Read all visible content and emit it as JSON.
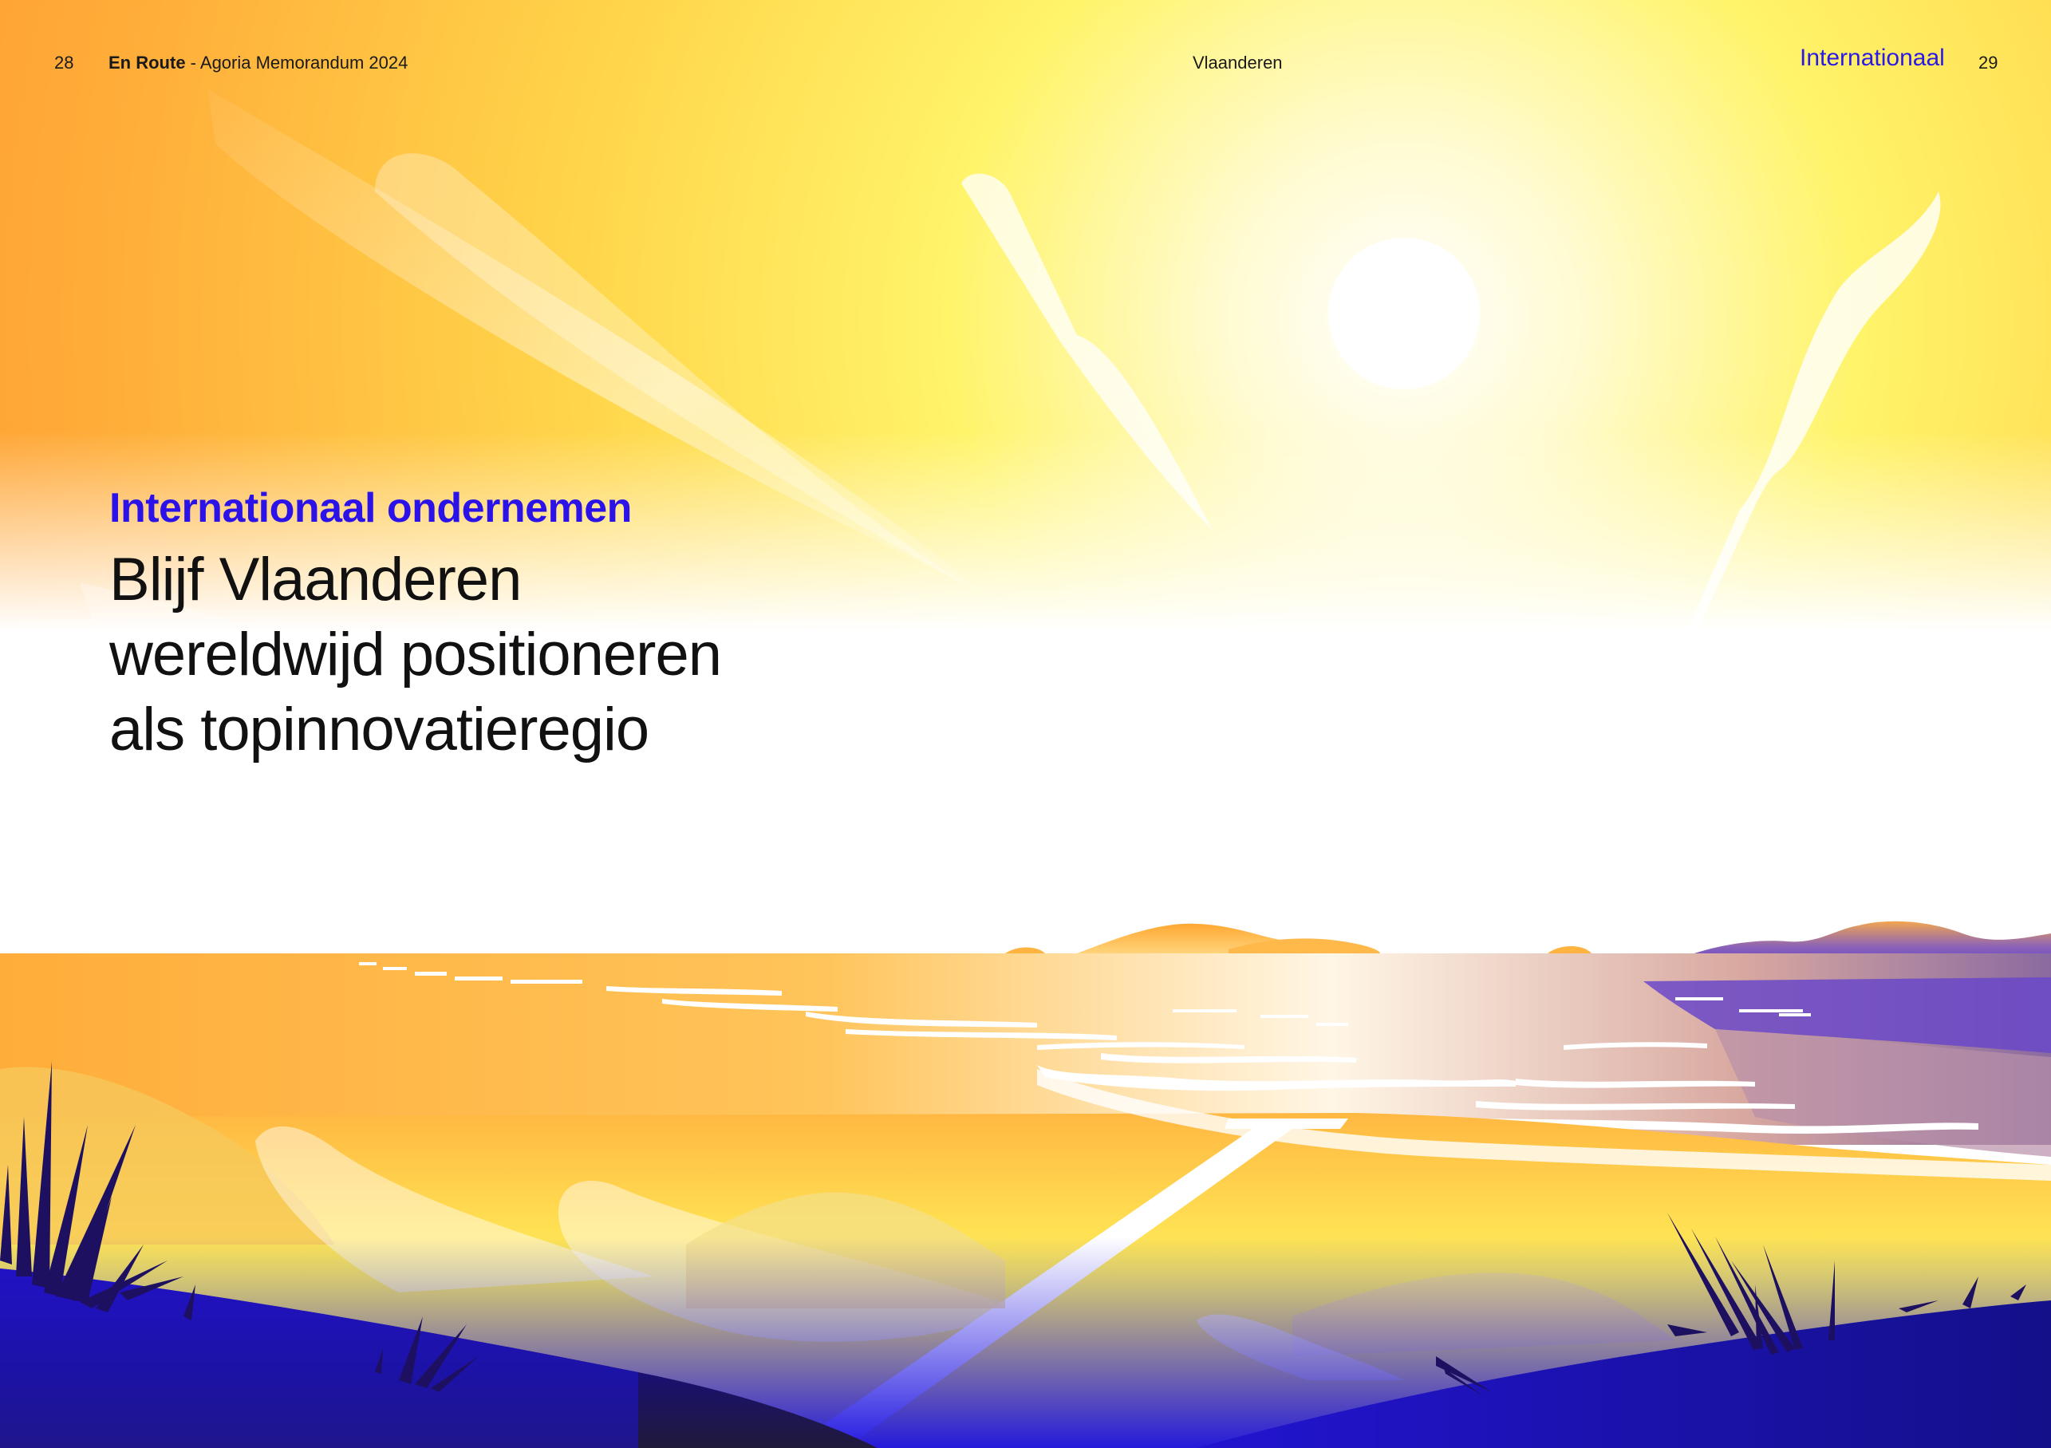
{
  "header": {
    "page_left": "28",
    "publication_bold": "En Route",
    "publication_rest": " - Agoria Memorandum 2024",
    "center_label": "Vlaanderen",
    "section": "Internationaal",
    "page_right": "29"
  },
  "content": {
    "kicker": "Internationaal ondernemen",
    "headline_lines": [
      "Blijf Vlaanderen",
      "wereldwijd positioneren",
      "als topinnovatieregio"
    ]
  },
  "colors": {
    "accent_blue": "#2a12e8",
    "sky_orange": "#ffae3a",
    "sky_yellow": "#fff35a",
    "ground_blue": "#1b0fd6"
  }
}
